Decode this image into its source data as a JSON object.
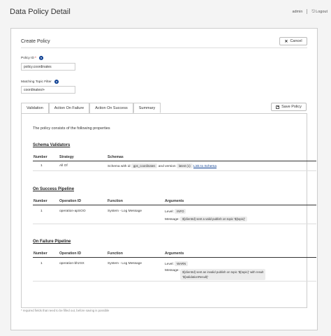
{
  "header": {
    "title": "Data Policy Detail",
    "user": "admin",
    "logout": "Logout"
  },
  "form": {
    "card_title": "Create Policy",
    "cancel_label": "Cancel",
    "policy_id_label": "Policy ID",
    "policy_id_value": "policy.coordinates",
    "topic_filter_label": "Matching Topic Filter",
    "topic_filter_value": "coordinates/+",
    "required_mark": "*",
    "help_glyph": "?"
  },
  "tabs": [
    {
      "label": "Validation",
      "active": false
    },
    {
      "label": "Action On Failure",
      "active": false
    },
    {
      "label": "Action On Success",
      "active": false
    },
    {
      "label": "Summary",
      "active": true
    }
  ],
  "save_label": "Save Policy",
  "summary": {
    "intro": "The policy consists of the following properties",
    "schema_validators": {
      "title": "Schema Validators",
      "headers": [
        "Number",
        "Strategy",
        "Schemas"
      ],
      "row": {
        "number": "1",
        "strategy": "All Of",
        "schemas_prefix": "Schema with id",
        "schema_id": "gps_coordinates",
        "version_text": "and version",
        "version": "latest (1)",
        "link": "Link to Schema"
      }
    },
    "success_pipeline": {
      "title": "On Success Pipeline",
      "headers": [
        "Number",
        "Operation ID",
        "Function",
        "Arguments"
      ],
      "row": {
        "number": "1",
        "operation_id": "operation-apSOO",
        "function": "System - Log Message",
        "level_label": "Level:",
        "level": "INFO",
        "message_label": "Message:",
        "message": "${clientId} sent a valid publish on topic '${topic}'"
      }
    },
    "failure_pipeline": {
      "title": "On Failure Pipeline",
      "headers": [
        "Number",
        "Operation ID",
        "Function",
        "Arguments"
      ],
      "row": {
        "number": "1",
        "operation_id": "operation-bhzSX",
        "function": "System - Log Message",
        "level_label": "Level:",
        "level": "WARN",
        "message_label": "Message:",
        "message_line1": "${clientId} sent an invalid publish on topic '${topic}' with result",
        "message_line2": "'${validationResult}'"
      }
    }
  },
  "footnote": "* required fields that need to be filled out, before saving is possible"
}
